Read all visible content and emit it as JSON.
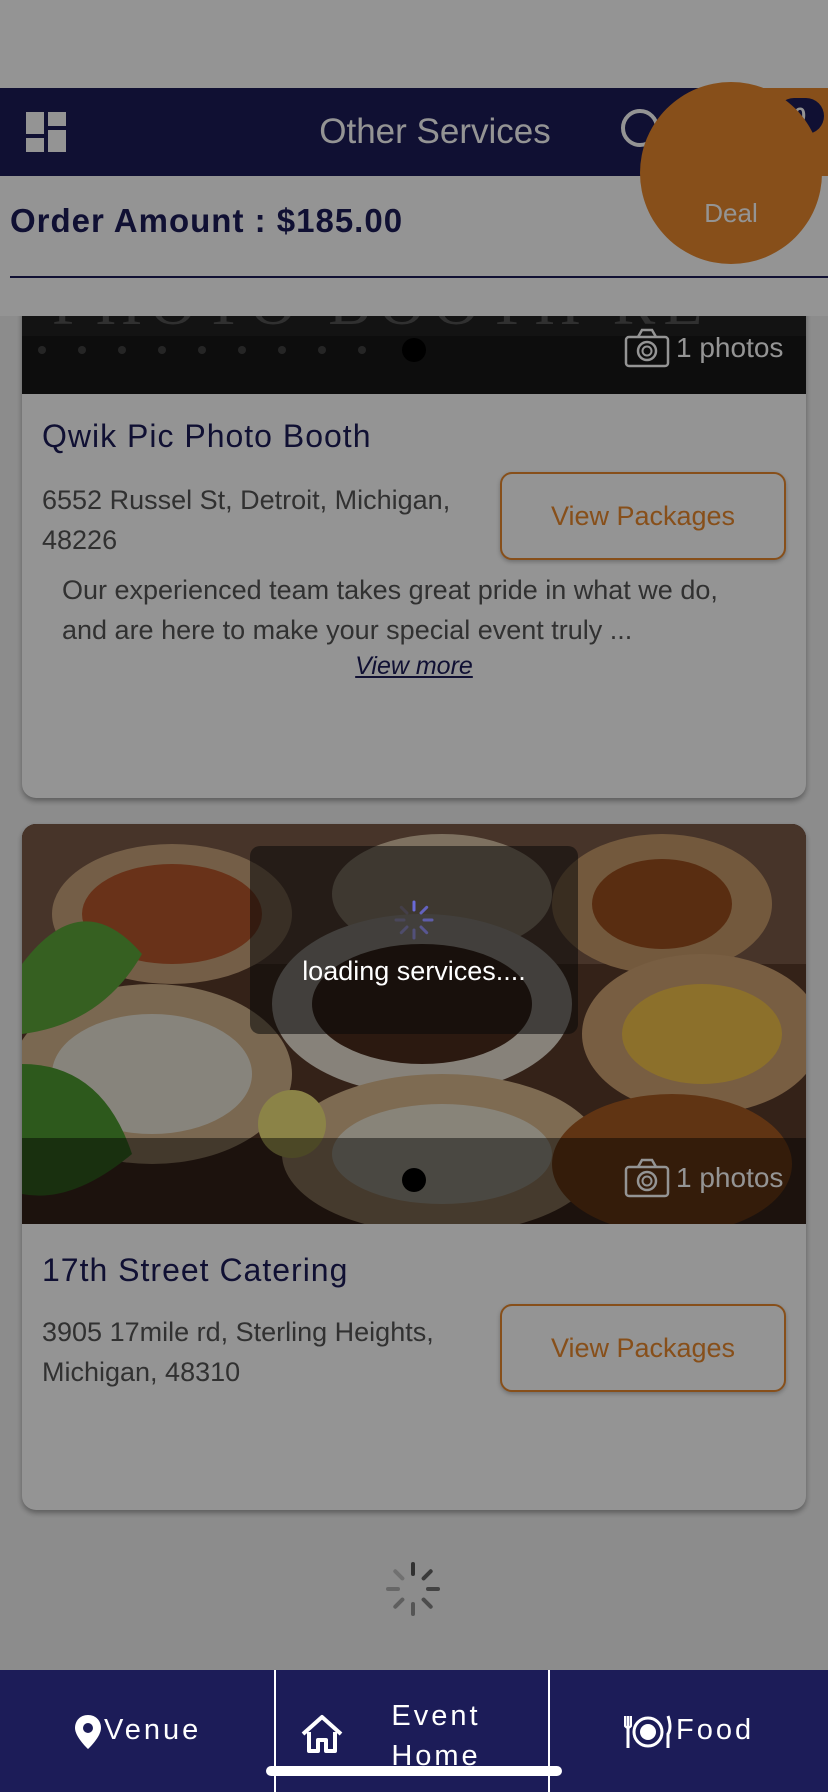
{
  "header": {
    "title": "Other Services",
    "cart_count": "0",
    "icons": [
      "grid-icon",
      "search-icon",
      "filter-icon",
      "cart-icon"
    ]
  },
  "order": {
    "amount_label": "Order Amount : $185.00",
    "deal_label": "Deal"
  },
  "listings": [
    {
      "name": "Qwik Pic Photo Booth",
      "address": "6552 Russel St, Detroit, Michigan, 48226",
      "photos_label": "1 photos",
      "button_label": "View Packages",
      "description": "Our experienced team takes great pride in what we do, and are here to make your special event truly ...",
      "view_more_label": "View more"
    },
    {
      "name": "17th Street Catering",
      "address": "3905 17mile rd, Sterling Heights, Michigan, 48310",
      "photos_label": "1 photos",
      "button_label": "View Packages"
    }
  ],
  "loading": {
    "text": "loading services...."
  },
  "nav": {
    "venue": "Venue",
    "home": "Event Home",
    "food": "Food"
  },
  "colors": {
    "primary": "#1c1c58",
    "accent": "#e8892d",
    "white": "#ffffff"
  }
}
